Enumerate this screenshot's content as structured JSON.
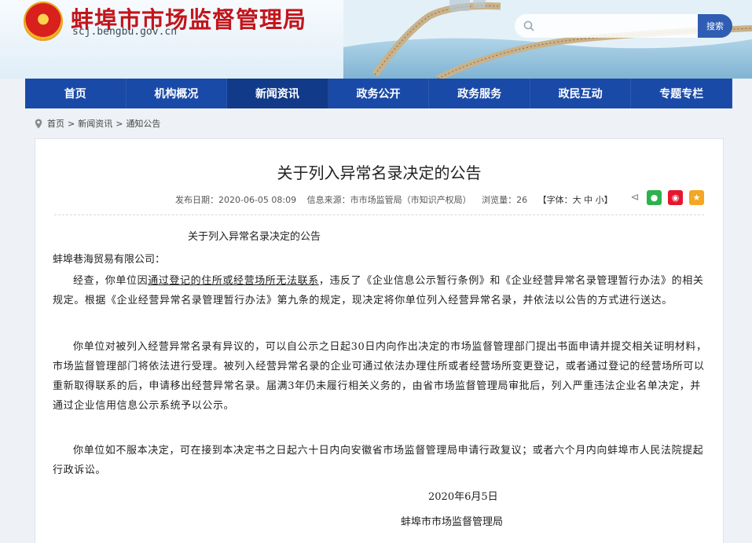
{
  "header": {
    "site_title": "蚌埠市市场监督管理局",
    "domain": "scj.bengbu.gov.cn",
    "search": {
      "placeholder": "",
      "button_label": "搜索"
    }
  },
  "nav": {
    "items": [
      {
        "label": "首页"
      },
      {
        "label": "机构概况"
      },
      {
        "label": "新闻资讯",
        "active": true
      },
      {
        "label": "政务公开"
      },
      {
        "label": "政务服务"
      },
      {
        "label": "政民互动"
      },
      {
        "label": "专题专栏"
      }
    ]
  },
  "breadcrumb": {
    "items": [
      "首页",
      "新闻资讯",
      "通知公告"
    ],
    "separator": ">"
  },
  "article": {
    "title": "关于列入异常名录决定的公告",
    "meta": {
      "publish_date": "发布日期：2020-06-05 08:09",
      "source": "信息来源：市市场监管局（市知识产权局）",
      "views_label": "浏览量：",
      "views": "26",
      "font_size": "【字体：大 中 小】"
    },
    "share_icons": [
      "share-icon",
      "wechat-icon",
      "weibo-icon",
      "favorite-icon"
    ],
    "doc_heading": "关于列入异常名录决定的公告",
    "addressee": "蚌埠巷海贸易有限公司：",
    "p1_a": "经查，你单位因",
    "p1_u": "通过登记的住所或经营场所无法联系",
    "p1_b": "，违反了《企业信息公示暂行条例》和《企业经营异常名录管理暂行办法》的相关规定。根据《企业经营异常名录管理暂行办法》第九条的规定，现决定将你单位列入经营异常名录，并依法以公告的方式进行送达。",
    "p2": "你单位对被列入经营异常名录有异议的，可以自公示之日起30日内向作出决定的市场监督管理部门提出书面申请并提交相关证明材料，市场监督管理部门将依法进行受理。被列入经营异常名录的企业可通过依法办理住所或者经营场所变更登记，或者通过登记的经营场所可以重新取得联系的后，申请移出经营异常名录。届满3年仍未履行相关义务的，由省市场监督管理局审批后，列入严重违法企业名单决定，并通过企业信用信息公示系统予以公示。",
    "p3": "你单位如不服本决定，可在接到本决定书之日起六十日内向安徽省市场监督管理局申请行政复议；或者六个月内向蚌埠市人民法院提起行政诉讼。",
    "date": "2020年6月5日",
    "issuer": "蚌埠市市场监督管理局"
  },
  "colors": {
    "nav_bg": "#1a4aa8",
    "nav_active": "#113a88",
    "title_red": "#c2151b",
    "search_btn": "#2f5db3"
  }
}
